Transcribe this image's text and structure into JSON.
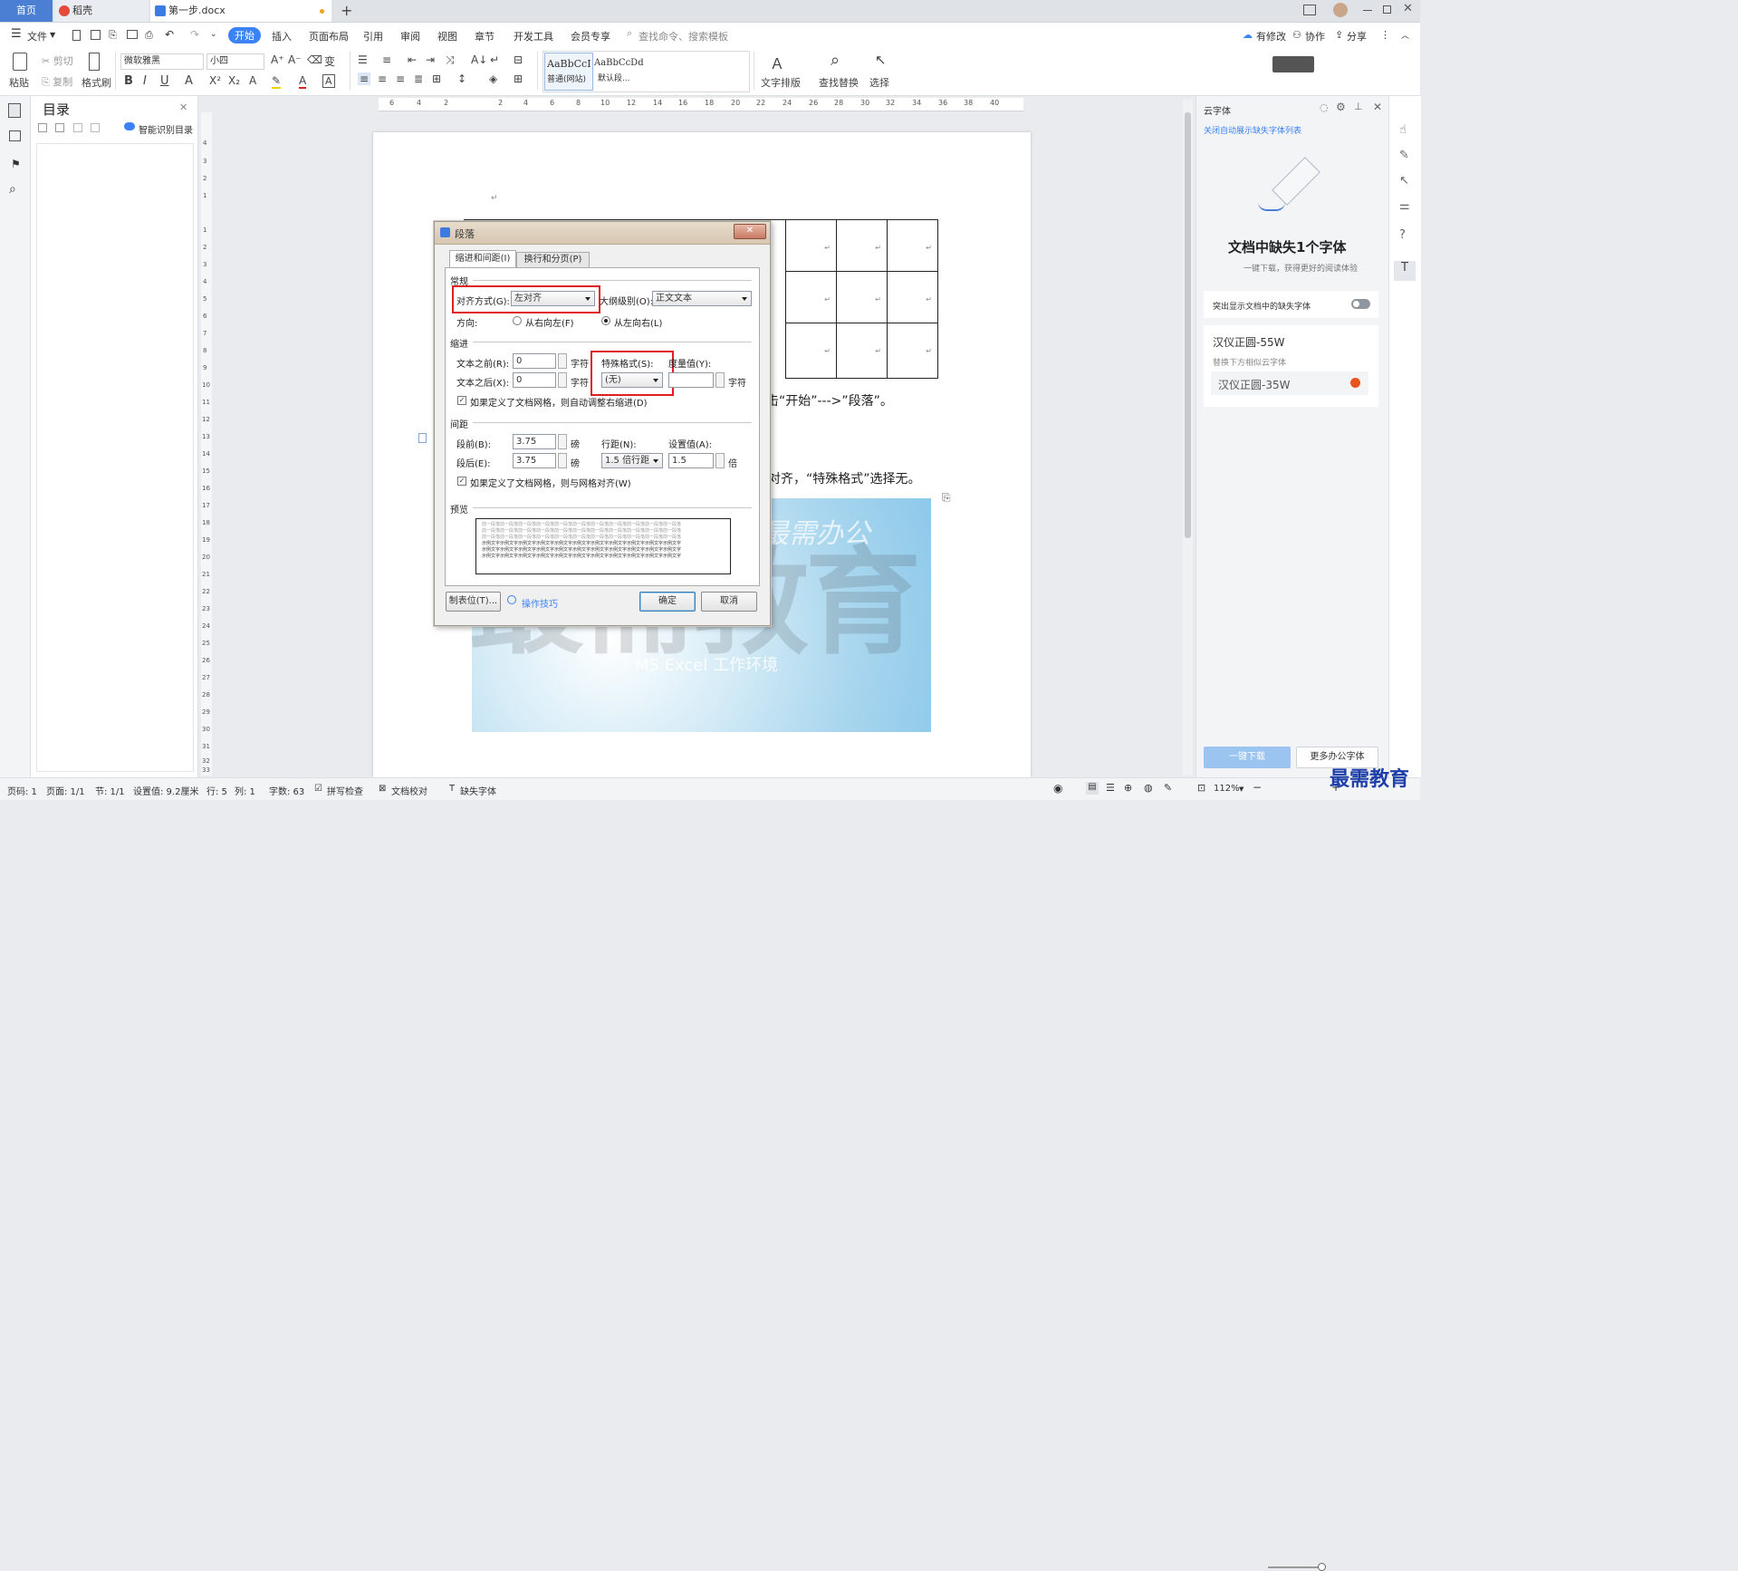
{
  "tabs": [
    {
      "label": "首页",
      "active": false
    },
    {
      "label": "稻壳",
      "active": false
    },
    {
      "label": "第一步.docx",
      "active": true
    }
  ],
  "menu": {
    "file": "文件",
    "items": [
      "开始",
      "插入",
      "页面布局",
      "引用",
      "审阅",
      "视图",
      "章节",
      "开发工具",
      "会员专享"
    ],
    "search_placeholder": "查找命令、搜索模板",
    "right": [
      "有修改",
      "协作",
      "分享"
    ]
  },
  "toolbar": {
    "paste": "粘贴",
    "cut": "剪切",
    "copy": "复制",
    "format_painter": "格式刷",
    "font_name": "微软雅黑",
    "font_size": "小四",
    "style1_preview": "AaBbCcI",
    "style1_label": "普通(网站)",
    "style2_preview": "AaBbCcDd",
    "style2_label": "默认段...",
    "text_layout": "文字排版",
    "find_replace": "查找替换",
    "select": "选择"
  },
  "outline": {
    "title": "目录",
    "smart_label": "智能识别目录"
  },
  "ruler_top": [
    "6",
    "4",
    "2",
    "2",
    "4",
    "6",
    "8",
    "10",
    "12",
    "14",
    "16",
    "18",
    "20",
    "22",
    "24",
    "26",
    "28",
    "30",
    "32",
    "34",
    "36",
    "38",
    "40"
  ],
  "ruler_left": [
    "4",
    "3",
    "2",
    "1",
    "1",
    "2",
    "3",
    "4",
    "5",
    "6",
    "7",
    "8",
    "9",
    "10",
    "11",
    "12",
    "13",
    "14",
    "15",
    "16",
    "17",
    "18",
    "19",
    "20",
    "21",
    "22",
    "23",
    "24",
    "25",
    "26",
    "27",
    "28",
    "29",
    "30",
    "31",
    "32",
    "33"
  ],
  "document": {
    "line1": "击“开始”--->”段落”。",
    "line2": "对齐，“特殊格式”选择无。",
    "watermark_big": "最需教育",
    "watermark_small": "MS Excel 工作环境",
    "watermark_top": "最需办公",
    "para_mark": "↵"
  },
  "dialog": {
    "title": "段落",
    "tab_indent": "缩进和间距(I)",
    "tab_break": "换行和分页(P)",
    "general": "常规",
    "align_label": "对齐方式(G):",
    "align_value": "左对齐",
    "outline_label": "大纲级别(O):",
    "outline_value": "正文文本",
    "direction_label": "方向:",
    "rtl": "从右向左(F)",
    "ltr": "从左向右(L)",
    "indent": "缩进",
    "before_label": "文本之前(R):",
    "before_value": "0",
    "after_label": "文本之后(X):",
    "after_value": "0",
    "unit_char": "字符",
    "special_label": "特殊格式(S):",
    "special_value": "(无)",
    "measure_label": "度量值(Y):",
    "measure_value": "",
    "grid_indent": "如果定义了文档网格，则自动调整右缩进(D)",
    "spacing": "间距",
    "space_before_label": "段前(B):",
    "space_before_value": "3.75",
    "space_after_label": "段后(E):",
    "space_after_value": "3.75",
    "unit_pt": "磅",
    "line_label": "行距(N):",
    "line_value": "1.5 倍行距",
    "setting_label": "设置值(A):",
    "setting_value": "1.5",
    "unit_times": "倍",
    "grid_align": "如果定义了文档网格，则与网格对齐(W)",
    "preview": "预览",
    "preview_line_prev": "前一段落前一段落前一段落前一段落前一段落前一段落前一段落前一段落前一段落前一段落前一段落",
    "preview_line_cur": "示例文字示例文字示例文字示例文字示例文字示例文字示例文字示例文字示例文字示例文字示例文字",
    "tabs_button": "制表位(T)...",
    "tips": "操作技巧",
    "ok": "确定",
    "cancel": "取消"
  },
  "rightpanel": {
    "title": "云字体",
    "link": "关闭自动展示缺失字体列表",
    "heading": "文档中缺失1个字体",
    "sub": "一键下载，获得更好的阅读体验",
    "highlight": "突出显示文档中的缺失字体",
    "missing_font": "汉仪正圆-55W",
    "replace_hint": "替换下方相似云字体",
    "similar_font": "汉仪正圆-35W",
    "download": "一键下载",
    "more": "更多办公字体"
  },
  "status": {
    "page_no": "页码: 1",
    "pages": "页面: 1/1",
    "section": "节: 1/1",
    "setting": "设置值: 9.2厘米",
    "row": "行: 5",
    "col": "列: 1",
    "words": "字数: 63",
    "spell": "拼写检查",
    "proof": "文档校对",
    "missing_font": "缺失字体",
    "zoom": "112%",
    "logo_text": "最需教育"
  }
}
